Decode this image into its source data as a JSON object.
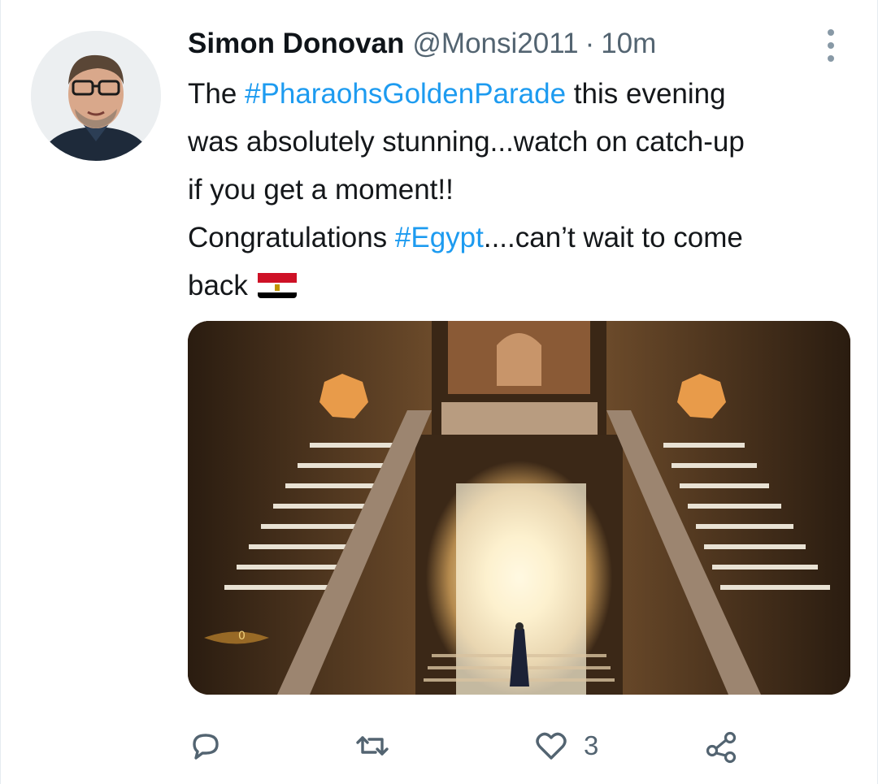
{
  "tweet": {
    "author_name": "Simon Donovan",
    "author_handle": "@Monsi2011",
    "separator": "·",
    "timestamp": "10m",
    "text": {
      "line1_pre": "The ",
      "hashtag1": "#PharaohsGoldenParade",
      "line1_post": " this evening",
      "line2": "was absolutely stunning...watch on catch-up",
      "line3": "if you get a moment!!",
      "line4_pre": "Congratulations ",
      "hashtag2": "#Egypt",
      "line4_post": "....can’t wait to come",
      "line5": "back"
    },
    "media_overlay_text": "0"
  },
  "actions": {
    "reply_count": "",
    "retweet_count": "",
    "like_count": "3",
    "share_count": ""
  },
  "colors": {
    "hashtag": "#1d9bf0",
    "secondary_text": "#536471",
    "more_dots": "#8899a6",
    "primary_text": "#0f1419"
  },
  "icons": {
    "more": "vertical-ellipsis-icon",
    "reply": "speech-bubble-icon",
    "retweet": "retweet-arrows-icon",
    "like": "heart-icon",
    "share": "share-nodes-icon",
    "flag": "egypt-flag-icon"
  }
}
